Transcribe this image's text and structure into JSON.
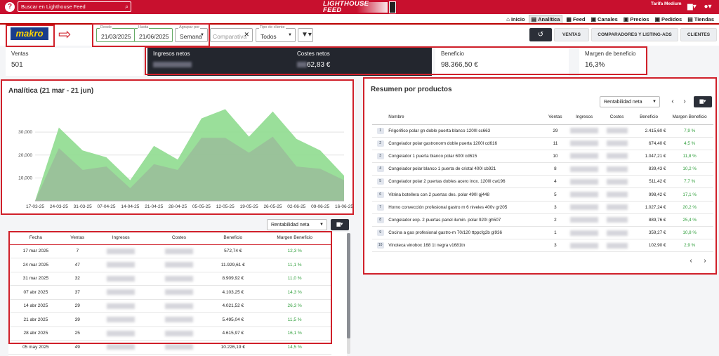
{
  "topbar": {
    "help_icon": "?",
    "search_placeholder": "Buscar en Lighthouse Feed",
    "logo_text": "LIGHTHOUSE FEED",
    "user": "Tarifa Medium"
  },
  "nav": [
    {
      "icon": "home-icon",
      "glyph": "⌂",
      "label": "Inicio"
    },
    {
      "icon": "chart-icon",
      "glyph": "▤",
      "label": "Analítica",
      "active": true
    },
    {
      "icon": "feed-icon",
      "glyph": "▦",
      "label": "Feed"
    },
    {
      "icon": "channels-icon",
      "glyph": "▣",
      "label": "Canales"
    },
    {
      "icon": "prices-icon",
      "glyph": "▣",
      "label": "Precios"
    },
    {
      "icon": "orders-icon",
      "glyph": "▣",
      "label": "Pedidos"
    },
    {
      "icon": "stores-icon",
      "glyph": "▤",
      "label": "Tiendas"
    }
  ],
  "filters": {
    "brand": "makro",
    "desde_label": "Desde",
    "desde": "21/03/2025",
    "hasta_label": "Hasta",
    "hasta": "21/06/2025",
    "agrupar_label": "Agrupar por",
    "agrupar": "Semana",
    "comparativa": "Comparativa",
    "tipo_label": "Tipo de cliente",
    "tipo": "Todos"
  },
  "tabs": [
    "VENTAS",
    "COMPARADORES Y LISTING-ADS",
    "CLIENTES"
  ],
  "kpis": [
    {
      "label": "Ventas",
      "value": "501"
    },
    {
      "label": "Ingresos netos",
      "value": ""
    },
    {
      "label": "Costes netos",
      "value": "62,83 €"
    },
    {
      "label": "Beneficio",
      "value": "98.366,50 €"
    },
    {
      "label": "Margen de beneficio",
      "value": "16,3%"
    }
  ],
  "chart": {
    "title": "Analítica (21 mar - 21 jun)"
  },
  "chart_data": {
    "type": "area",
    "x": [
      "17-03-25",
      "24-03-25",
      "31-03-25",
      "07-04-25",
      "14-04-25",
      "21-04-25",
      "28-04-25",
      "05-05-25",
      "12-05-25",
      "19-05-25",
      "26-05-25",
      "02-06-25",
      "09-06-25",
      "16-06-25"
    ],
    "series": [
      {
        "values": [
          0,
          32000,
          22000,
          19000,
          9000,
          24000,
          18000,
          36000,
          40000,
          28000,
          39000,
          27000,
          22000,
          11000
        ],
        "color": "#8fdc8f"
      },
      {
        "values": [
          0,
          23000,
          13500,
          15000,
          5500,
          16000,
          13500,
          27500,
          27500,
          21000,
          28000,
          15000,
          14000,
          9000
        ],
        "color": "#9ab89a"
      }
    ],
    "yticks": [
      "10,000",
      "20,000",
      "30,000"
    ],
    "ylim": [
      0,
      42000
    ],
    "grid": true
  },
  "left_table": {
    "sort_label": "Rentabilidad neta",
    "headers": [
      "Fecha",
      "Ventas",
      "Ingresos",
      "Costes",
      "Beneficio",
      "Margen Beneficio"
    ],
    "rows": [
      {
        "fecha": "17 mar 2025",
        "ventas": "7",
        "beneficio": "572,74 €",
        "margen": "12,3 %"
      },
      {
        "fecha": "24 mar 2025",
        "ventas": "47",
        "beneficio": "11.929,61 €",
        "margen": "11,1 %"
      },
      {
        "fecha": "31 mar 2025",
        "ventas": "32",
        "beneficio": "8.909,92 €",
        "margen": "11,0 %"
      },
      {
        "fecha": "07 abr 2025",
        "ventas": "37",
        "beneficio": "4.103,25 €",
        "margen": "14,3 %"
      },
      {
        "fecha": "14 abr 2025",
        "ventas": "29",
        "beneficio": "4.021,52 €",
        "margen": "26,3 %"
      },
      {
        "fecha": "21 abr 2025",
        "ventas": "39",
        "beneficio": "5.495,04 €",
        "margen": "11,5 %"
      },
      {
        "fecha": "28 abr 2025",
        "ventas": "25",
        "beneficio": "4.615,97 €",
        "margen": "16,1 %"
      },
      {
        "fecha": "05 may 2025",
        "ventas": "49",
        "beneficio": "10.226,19 €",
        "margen": "14,5 %"
      }
    ]
  },
  "right_panel": {
    "title": "Resumen por productos",
    "sort_label": "Rentabilidad neta",
    "headers": [
      "Nombre",
      "Ventas",
      "Ingresos",
      "Costes",
      "Beneficio",
      "Margen Beneficio"
    ],
    "rows": [
      {
        "n": "1",
        "nombre": "Frigorifico polar gn doble puerta blanco 1200l cc663",
        "ventas": "29",
        "beneficio": "2.415,60 €",
        "margen": "7,9 %"
      },
      {
        "n": "2",
        "nombre": "Congelador polar gastronorm doble puerta 1200l cd616",
        "ventas": "11",
        "beneficio": "674,40 €",
        "margen": "4,5 %"
      },
      {
        "n": "3",
        "nombre": "Congelador 1 puerta blanco polar 600l cd615",
        "ventas": "10",
        "beneficio": "1.047,21 €",
        "margen": "11,8 %"
      },
      {
        "n": "4",
        "nombre": "Congelador polar blanco 1 puerta de cristal 400l cb921",
        "ventas": "8",
        "beneficio": "839,43 €",
        "margen": "10,2 %"
      },
      {
        "n": "5",
        "nombre": "Congelador polar 2 puertas dobles acero inox. 1200l cw196",
        "ventas": "4",
        "beneficio": "511,42 €",
        "margen": "7,7 %"
      },
      {
        "n": "6",
        "nombre": "Vitrina botellera con 2 puertas des. polar 490l gj448",
        "ventas": "5",
        "beneficio": "998,42 €",
        "margen": "17,1 %"
      },
      {
        "n": "7",
        "nombre": "Horno convección profesional gastro m 6 niveles 400v gr205",
        "ventas": "3",
        "beneficio": "1.027,24 €",
        "margen": "20,2 %"
      },
      {
        "n": "8",
        "nombre": "Congelador exp. 2 puertas panel ilumin. polar 920l gh507",
        "ventas": "2",
        "beneficio": "889,76 €",
        "margen": "25,4 %"
      },
      {
        "n": "9",
        "nombre": "Cocina a gas profesional gastro-m 70/120 ttppcfg2b gl936",
        "ventas": "1",
        "beneficio": "359,27 €",
        "margen": "10,8 %"
      },
      {
        "n": "10",
        "nombre": "Vinoteca vinobox 168 1t negra v1681tn",
        "ventas": "3",
        "beneficio": "102,90 €",
        "margen": "2,9 %"
      }
    ]
  }
}
